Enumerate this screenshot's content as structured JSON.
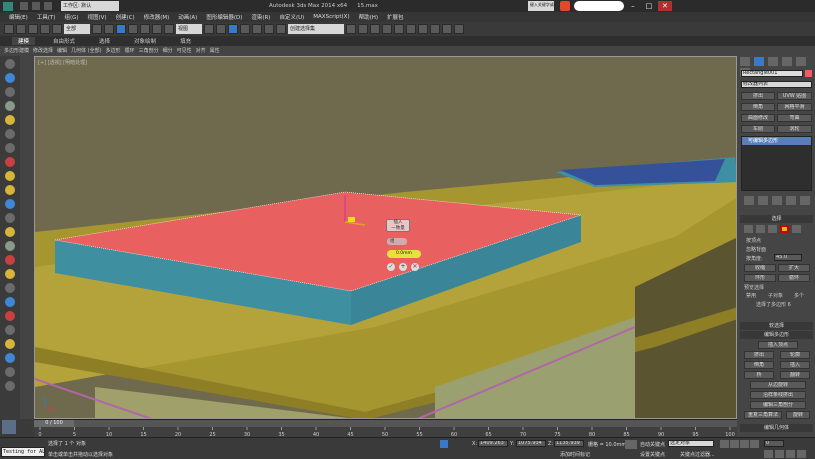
{
  "title_bar": {
    "workspace_label": "工作区: 默认",
    "app_title": "Autodesk 3ds Max  2014 x64",
    "file_name": "15.max",
    "search_placeholder": "键入关键字或短语",
    "help_label": "帮助"
  },
  "menu": [
    "编辑(E)",
    "工具(T)",
    "组(G)",
    "视图(V)",
    "创建(C)",
    "修改器(M)",
    "动画(A)",
    "图形编辑器(D)",
    "渲染(R)",
    "自定义(U)",
    "MAXScript(X)",
    "帮助(H)",
    "扩展包"
  ],
  "toolbar": {
    "filter_dropdown": "全部",
    "view_dropdown": "视图",
    "selection_set": "创建选择集"
  },
  "ribbon_tabs": [
    "建模",
    "自由形式",
    "选择",
    "对象绘制",
    "填充"
  ],
  "active_ribbon_tab": "建模",
  "sub_ribbon": [
    "多边形建模",
    "修改选择",
    "编辑",
    "几何体 (全部)",
    "多边形",
    "循环",
    "三角剖分",
    "细分",
    "可见性",
    "对齐",
    "属性"
  ],
  "viewport": {
    "label": "[+] [透视] [明暗处理]",
    "caddy": {
      "title": "插入",
      "subtitle": "一致量",
      "mode": "组",
      "value": "0.0",
      "value_suffix": "mm"
    }
  },
  "command_panel": {
    "object_name": "Rectangle001",
    "modifier_list": "修改器列表",
    "buttons": [
      "挤出",
      "UVW 贴图",
      "倒角",
      "网格平滑",
      "曲面修改",
      "弯曲",
      "车削",
      "涡轮"
    ],
    "stack_item": "可编辑多边形",
    "selection_header": "选择",
    "by_vertex": "按顶点",
    "ignore_backfacing": "忽略背面",
    "by_angle": "按角度:",
    "angle_value": "45.0",
    "shrink": "收缩",
    "grow": "扩大",
    "ring": "环形",
    "loop": "循环",
    "preview_label": "预览选择",
    "preview_options": [
      "禁用",
      "子对象",
      "多个"
    ],
    "selection_status": "选择了多边形 6",
    "soft_selection": "软选择",
    "edit_polygons": "编辑多边形",
    "insert_vertex": "插入顶点",
    "extrude": "挤出",
    "outline": "轮廓",
    "bevel": "倒角",
    "inset": "插入",
    "bridge": "桥",
    "flip": "翻转",
    "hinge_from_edge": "从边旋转",
    "extrude_along_spline": "沿样条线挤出",
    "edit_triangulation": "编辑三角剖分",
    "retriangulate": "重复三角算法",
    "turn": "旋转",
    "edit_geometry": "编辑几何体"
  },
  "timeline": {
    "frame_display": "0 / 100",
    "ticks": [
      "0",
      "5",
      "10",
      "15",
      "20",
      "25",
      "30",
      "35",
      "40",
      "45",
      "50",
      "55",
      "60",
      "65",
      "70",
      "75",
      "80",
      "85",
      "90",
      "95",
      "100"
    ]
  },
  "status": {
    "maxscript": "Testing for ALL",
    "selection_msg": "选择了 1 个 对象",
    "prompt": "单击或单击并拖动以选择对象",
    "x_label": "X:",
    "x_value": "1409.263",
    "y_label": "Y:",
    "y_value": "1075.934",
    "z_label": "Z:",
    "z_value": "1135.939",
    "grid": "栅格 = 10.0mm",
    "add_time_tag": "添加时间标记",
    "auto_key": "自动关键点",
    "selected_dropdown": "选定对象",
    "set_key": "设置关键点",
    "key_filters": "关键点过滤器...",
    "frame_value": "0"
  },
  "colors": {
    "selected_face": "#e86060",
    "box_side": "#3e8fa0",
    "table": "#b3a33a",
    "accent_blue": "#3a78c8"
  }
}
